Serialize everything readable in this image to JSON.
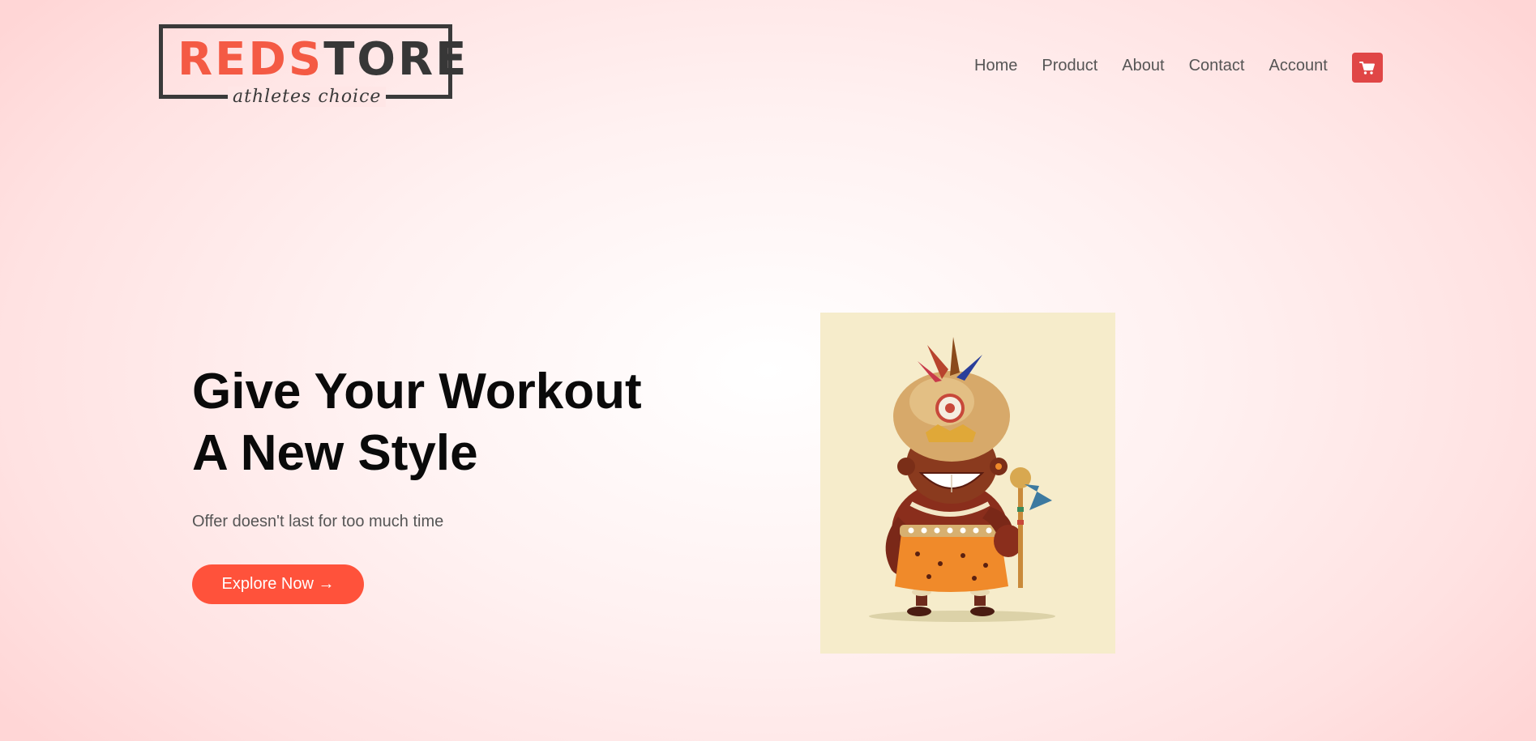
{
  "logo": {
    "word_red": "REDS",
    "word_dark": "TORE",
    "tagline": "athletes choice"
  },
  "nav": {
    "items": [
      "Home",
      "Product",
      "About",
      "Contact",
      "Account"
    ],
    "cart_icon": "shopping-cart-icon"
  },
  "hero": {
    "title_line1": "Give Your Workout",
    "title_line2": "A New Style",
    "subtitle": "Offer doesn't last for too much time",
    "button_label": "Explore Now →",
    "image_subject": "tribal-chief-illustration"
  },
  "colors": {
    "accent": "#ff523b",
    "cart_bg": "#e04646",
    "logo_red": "#f45a44",
    "logo_dark": "#373737",
    "image_bg": "#f6eccb"
  }
}
